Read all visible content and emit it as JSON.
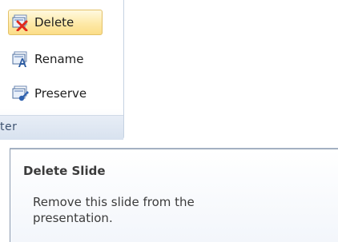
{
  "ribbon": {
    "buttons": [
      {
        "label": "Delete",
        "icon": "delete-slide-icon",
        "state": "hover"
      },
      {
        "label": "Rename",
        "icon": "rename-slide-icon"
      },
      {
        "label": "Preserve",
        "icon": "preserve-slide-icon"
      }
    ],
    "group_label": "ter"
  },
  "tooltip": {
    "title": "Delete Slide",
    "description": "Remove this slide from the presentation."
  },
  "colors": {
    "hover_fill": "#fde9a8",
    "hover_border": "#e3c168",
    "group_footer": "#dbe4f0",
    "tooltip_border": "#8c9bb0",
    "text": "#3b3b3b",
    "delete_x": "#e02a1b"
  }
}
